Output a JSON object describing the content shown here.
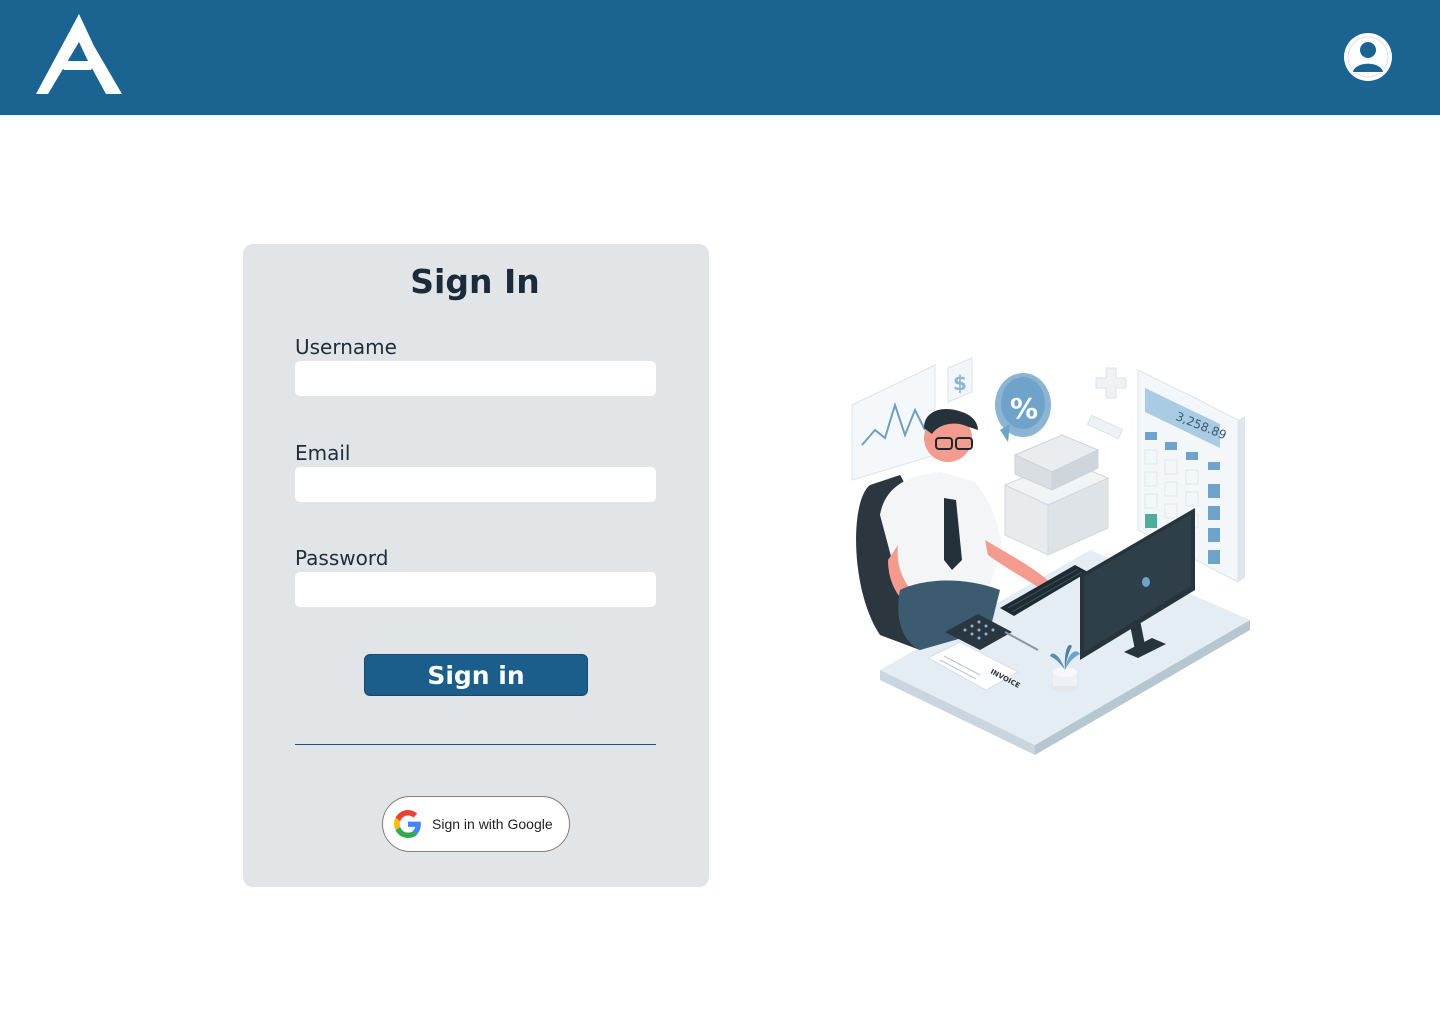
{
  "header": {
    "logo_icon": "stylized-letter-a-logo",
    "profile_icon": "user-avatar-icon"
  },
  "signin": {
    "title": "Sign In",
    "username_label": "Username",
    "username_value": "",
    "email_label": "Email",
    "email_value": "",
    "password_label": "Password",
    "password_value": "",
    "submit_label": "Sign in",
    "google_label": "Sign in with Google",
    "google_icon": "google-g-icon"
  },
  "illustration": {
    "calculator_display": "3,258.89",
    "invoice_label": "INVOICE",
    "percent_symbol": "%",
    "dollar_symbol": "$"
  },
  "colors": {
    "header_bg": "#1b6391",
    "card_bg": "#e2e5e8",
    "primary_button": "#1b5d8b",
    "text_dark": "#1b2b3a"
  }
}
